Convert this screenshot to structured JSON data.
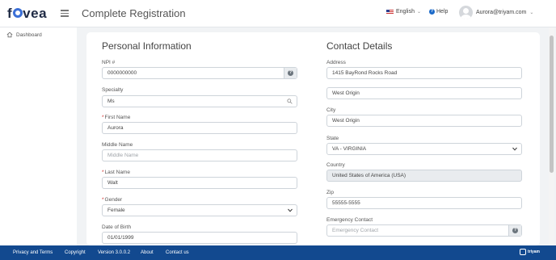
{
  "header": {
    "logo": "fovea",
    "title": "Complete Registration",
    "language": "English",
    "help": "Help",
    "user_email": "Aurora@triyam.com"
  },
  "sidebar": {
    "items": [
      {
        "label": "Dashboard",
        "icon": "home-icon"
      }
    ]
  },
  "personal": {
    "title": "Personal Information",
    "npi": {
      "label": "NPI #",
      "value": "0000000000"
    },
    "specialty": {
      "label": "Specialty",
      "value": "Ms"
    },
    "first_name": {
      "label": "First Name",
      "value": "Aurora",
      "required": true
    },
    "middle_name": {
      "label": "Middle Name",
      "placeholder": "Middle Name"
    },
    "last_name": {
      "label": "Last Name",
      "value": "Walt",
      "required": true
    },
    "gender": {
      "label": "Gender",
      "value": "Female",
      "required": true
    },
    "dob": {
      "label": "Date of Birth",
      "value": "01/01/1999"
    }
  },
  "contact": {
    "title": "Contact Details",
    "address": {
      "label": "Address",
      "value": "1415 BayRond Rocks Road"
    },
    "address2": {
      "value": "West Origin"
    },
    "city": {
      "label": "City",
      "value": "West Origin"
    },
    "state": {
      "label": "State",
      "value": "VA - VIRGINIA"
    },
    "country": {
      "label": "Country",
      "value": "United States of America (USA)"
    },
    "zip": {
      "label": "Zip",
      "value": "55555-5555"
    },
    "emergency": {
      "label": "Emergency Contact",
      "placeholder": "Emergency Contact"
    }
  },
  "footer": {
    "privacy": "Privacy and Terms",
    "copyright": "Copyright",
    "version": "Version 3.0.0.2",
    "about": "About",
    "contact": "Contact us",
    "brand": "triyam"
  },
  "colors": {
    "footer_bg": "#12498f",
    "accent": "#3b6fd6",
    "required": "#d0312d"
  }
}
